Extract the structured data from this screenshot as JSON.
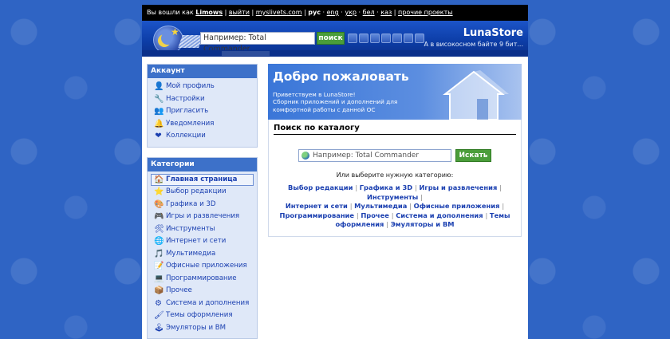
{
  "topbar": {
    "logged_in_as": "Вы вошли как",
    "username": "Limows",
    "logout": "выйти",
    "blog": "myslivets.com",
    "lang_current": "рус",
    "langs": [
      "eng",
      "укр",
      "бел",
      "каз"
    ],
    "other_projects": "прочие проекты"
  },
  "header": {
    "search_placeholder": "Например: Total Commander",
    "search_button": "поиск",
    "brand_name": "LunaStore",
    "slogan": "А в високосном байте 9 бит..."
  },
  "account": {
    "title": "Аккаунт",
    "items": [
      {
        "label": "Мой профиль",
        "icon": "profile-icon"
      },
      {
        "label": "Настройки",
        "icon": "settings-icon"
      },
      {
        "label": "Пригласить",
        "icon": "invite-icon"
      },
      {
        "label": "Уведомления",
        "icon": "notifications-icon"
      },
      {
        "label": "Коллекции",
        "icon": "collections-icon"
      }
    ]
  },
  "categories": {
    "title": "Категории",
    "items": [
      {
        "label": "Главная страница",
        "icon": "home-icon"
      },
      {
        "label": "Выбор редакции",
        "icon": "star-icon"
      },
      {
        "label": "Графика и 3D",
        "icon": "graphics-icon"
      },
      {
        "label": "Игры и развлечения",
        "icon": "games-icon"
      },
      {
        "label": "Инструменты",
        "icon": "tools-icon"
      },
      {
        "label": "Интернет и сети",
        "icon": "network-icon"
      },
      {
        "label": "Мультимедиа",
        "icon": "multimedia-icon"
      },
      {
        "label": "Офисные приложения",
        "icon": "office-icon"
      },
      {
        "label": "Программирование",
        "icon": "programming-icon"
      },
      {
        "label": "Прочее",
        "icon": "misc-icon"
      },
      {
        "label": "Система и дополнения",
        "icon": "system-icon"
      },
      {
        "label": "Темы оформления",
        "icon": "themes-icon"
      },
      {
        "label": "Эмуляторы и ВМ",
        "icon": "emulators-icon"
      }
    ]
  },
  "welcome": {
    "title": "Добро пожаловать",
    "line1": "Приветствуем в LunaStore!",
    "line2": "Сборник приложений и дополнений для",
    "line3": "комфортной работы с данной ОС"
  },
  "catalog": {
    "title": "Поиск по каталогу",
    "placeholder": "Например: Total Commander",
    "button": "Искать",
    "hint": "Или выберите нужную категорию:",
    "links": [
      "Выбор редакции",
      "Графика и 3D",
      "Игры и развлечения",
      "Инструменты",
      "Интернет и сети",
      "Мультимедиа",
      "Офисные приложения",
      "Программирование",
      "Прочее",
      "Система и дополнения",
      "Темы оформления",
      "Эмуляторы и ВМ"
    ]
  },
  "colors": {
    "background": "#2f64c4",
    "accent": "#3d71c9",
    "link": "#1a3fb0",
    "button_green": "#4a9d3a"
  }
}
